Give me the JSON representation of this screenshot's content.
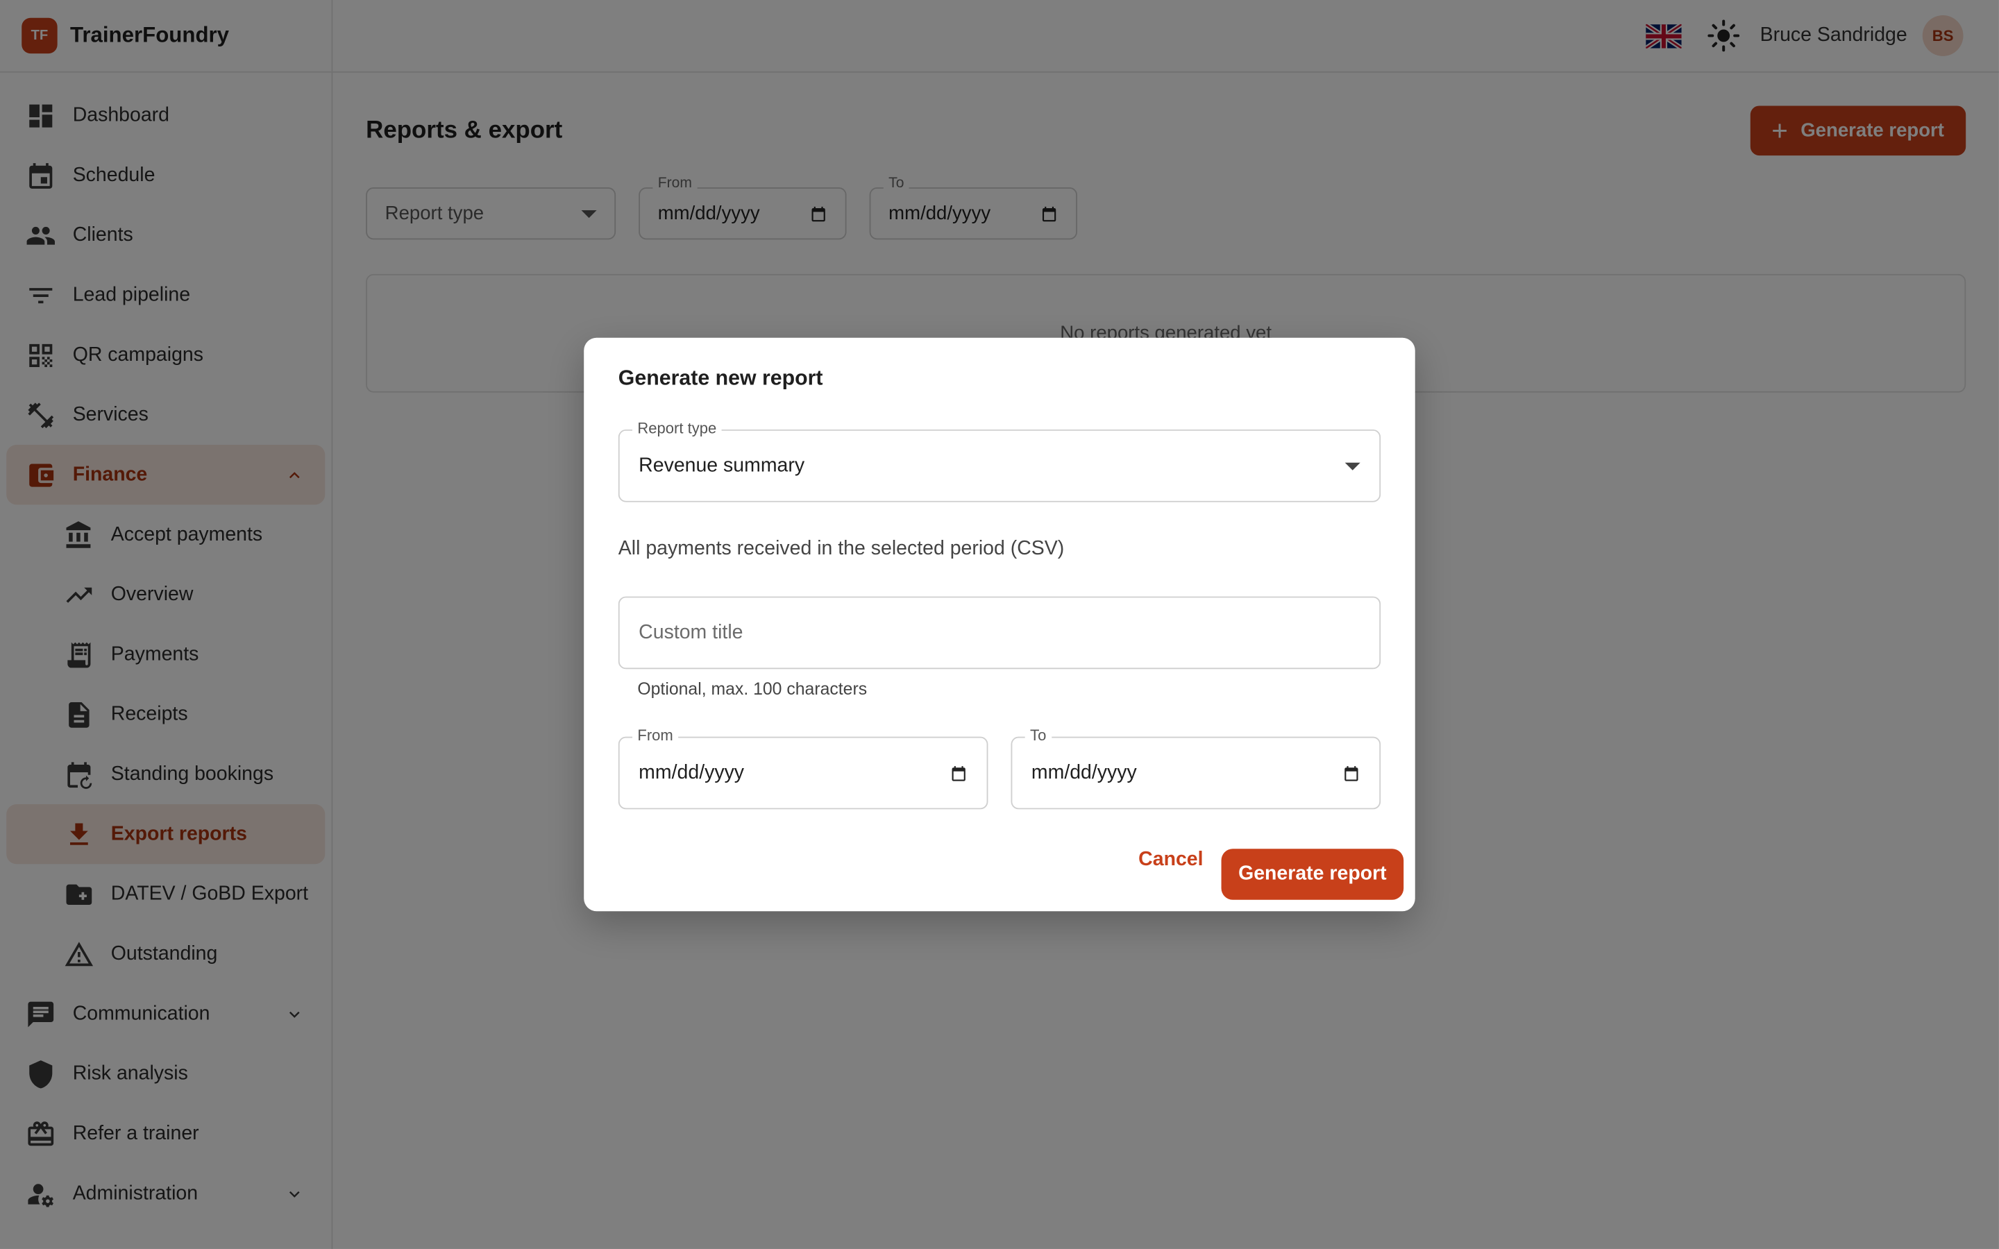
{
  "app": {
    "brand_initials": "TF",
    "brand_name": "TrainerFoundry"
  },
  "sidebar": {
    "items": [
      {
        "label": "Dashboard",
        "icon": "dashboard-icon"
      },
      {
        "label": "Schedule",
        "icon": "calendar-icon"
      },
      {
        "label": "Clients",
        "icon": "people-icon"
      },
      {
        "label": "Lead pipeline",
        "icon": "filter-icon"
      },
      {
        "label": "QR campaigns",
        "icon": "qr-code-icon"
      },
      {
        "label": "Services",
        "icon": "dumbbell-icon"
      },
      {
        "label": "Finance",
        "icon": "wallet-icon",
        "expanded": true
      },
      {
        "label": "Accept payments",
        "icon": "bank-icon"
      },
      {
        "label": "Overview",
        "icon": "trending-up-icon"
      },
      {
        "label": "Payments",
        "icon": "receipt-long-icon"
      },
      {
        "label": "Receipts",
        "icon": "document-icon"
      },
      {
        "label": "Standing bookings",
        "icon": "recurring-calendar-icon"
      },
      {
        "label": "Export reports",
        "icon": "download-icon",
        "active": true
      },
      {
        "label": "DATEV / GoBD Export",
        "icon": "folder-icon"
      },
      {
        "label": "Outstanding",
        "icon": "warning-icon"
      },
      {
        "label": "Communication",
        "icon": "chat-icon"
      },
      {
        "label": "Risk analysis",
        "icon": "shield-icon"
      },
      {
        "label": "Refer a trainer",
        "icon": "gift-card-icon"
      },
      {
        "label": "Administration",
        "icon": "admin-gear-icon"
      }
    ]
  },
  "header": {
    "user_name": "Bruce Sandridge",
    "user_initials": "BS"
  },
  "page": {
    "title": "Reports & export",
    "generate_button": "Generate report",
    "filters": {
      "report_type_placeholder": "Report type",
      "from_label": "From",
      "from_value": "mm/dd/yyyy",
      "to_label": "To",
      "to_value": "mm/dd/yyyy"
    },
    "empty_text": "No reports generated yet"
  },
  "modal": {
    "title": "Generate new report",
    "report_type_label": "Report type",
    "report_type_value": "Revenue summary",
    "description": "All payments received in the selected period (CSV)",
    "custom_title_placeholder": "Custom title",
    "helper": "Optional, max. 100 characters",
    "from_label": "From",
    "from_value": "mm/dd/yyyy",
    "to_label": "To",
    "to_value": "mm/dd/yyyy",
    "cancel": "Cancel",
    "submit": "Generate report"
  },
  "colors": {
    "accent": "#c8401a",
    "accent_bg": "#f7e6df",
    "overlay": "rgba(0,0,0,0.5)"
  }
}
